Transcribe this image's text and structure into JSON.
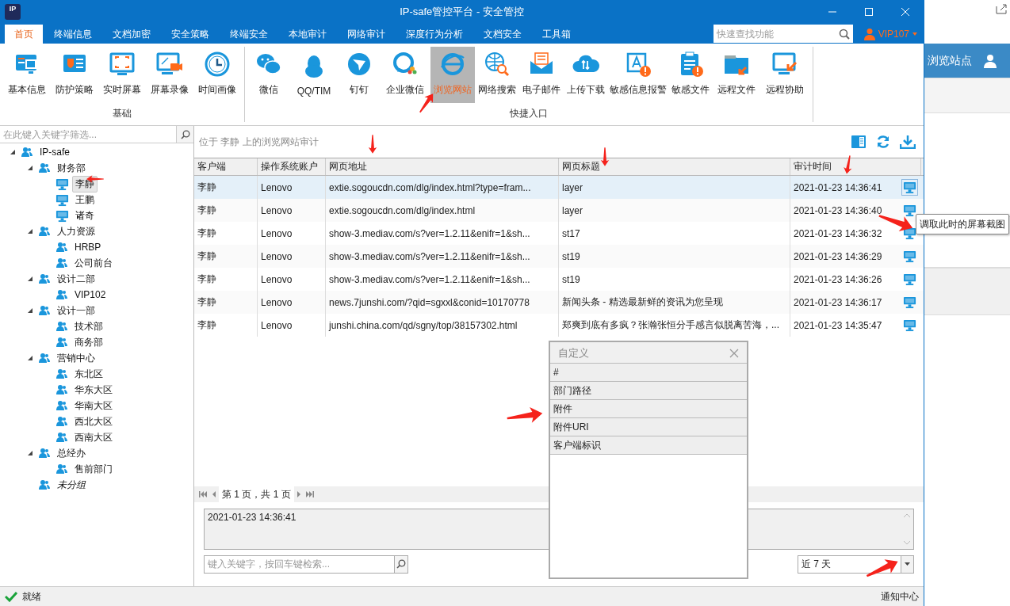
{
  "window": {
    "title": "IP-safe管控平台 - 安全管控",
    "logo": "IP"
  },
  "menu_tabs": [
    {
      "label": "首页",
      "selected": true
    },
    {
      "label": "终端信息",
      "selected": false
    },
    {
      "label": "文档加密",
      "selected": false
    },
    {
      "label": "安全策略",
      "selected": false
    },
    {
      "label": "终端安全",
      "selected": false
    },
    {
      "label": "本地审计",
      "selected": false
    },
    {
      "label": "网络审计",
      "selected": false
    },
    {
      "label": "深度行为分析",
      "selected": false
    },
    {
      "label": "文档安全",
      "selected": false
    },
    {
      "label": "工具箱",
      "selected": false
    }
  ],
  "search": {
    "placeholder": "快速查找功能"
  },
  "user": {
    "name": "VIP107"
  },
  "ribbon_groups": [
    {
      "title": "基础",
      "items": [
        {
          "label": "基本信息",
          "selected": false
        },
        {
          "label": "防护策略",
          "selected": false
        },
        {
          "label": "实时屏幕",
          "selected": false
        },
        {
          "label": "屏幕录像",
          "selected": false
        },
        {
          "label": "时间画像",
          "selected": false
        }
      ]
    },
    {
      "title": "快捷入口",
      "items": [
        {
          "label": "微信",
          "selected": false
        },
        {
          "label": "QQ/TIM",
          "selected": false
        },
        {
          "label": "钉钉",
          "selected": false
        },
        {
          "label": "企业微信",
          "selected": false
        },
        {
          "label": "浏览网站",
          "selected": true
        },
        {
          "label": "网络搜索",
          "selected": false
        },
        {
          "label": "电子邮件",
          "selected": false
        },
        {
          "label": "上传下载",
          "selected": false
        },
        {
          "label": "敏感信息报警",
          "selected": false
        },
        {
          "label": "敏感文件",
          "selected": false
        },
        {
          "label": "远程文件",
          "selected": false
        },
        {
          "label": "远程协助",
          "selected": false
        }
      ]
    }
  ],
  "tree": {
    "filter_placeholder": "在此键入关键字筛选...",
    "nodes": [
      {
        "label": "IP-safe",
        "kind": "group",
        "expanded": true,
        "children": [
          {
            "label": "财务部",
            "kind": "group",
            "expanded": true,
            "children": [
              {
                "label": "李静",
                "kind": "computer",
                "selected": true
              },
              {
                "label": "王鹏",
                "kind": "computer",
                "selected": false
              },
              {
                "label": "诸奇",
                "kind": "computer",
                "selected": false
              }
            ]
          },
          {
            "label": "人力资源",
            "kind": "group",
            "expanded": true,
            "children": [
              {
                "label": "HRBP",
                "kind": "group"
              },
              {
                "label": "公司前台",
                "kind": "group"
              }
            ]
          },
          {
            "label": "设计二部",
            "kind": "group",
            "expanded": true,
            "children": [
              {
                "label": "VIP102",
                "kind": "group"
              }
            ]
          },
          {
            "label": "设计一部",
            "kind": "group",
            "expanded": true,
            "children": [
              {
                "label": "技术部",
                "kind": "group"
              },
              {
                "label": "商务部",
                "kind": "group"
              }
            ]
          },
          {
            "label": "营销中心",
            "kind": "group",
            "expanded": true,
            "children": [
              {
                "label": "东北区",
                "kind": "group"
              },
              {
                "label": "华东大区",
                "kind": "group"
              },
              {
                "label": "华南大区",
                "kind": "group"
              },
              {
                "label": "西北大区",
                "kind": "group"
              },
              {
                "label": "西南大区",
                "kind": "group"
              }
            ]
          },
          {
            "label": "总经办",
            "kind": "group",
            "expanded": true,
            "children": [
              {
                "label": "售前部门",
                "kind": "group"
              }
            ]
          },
          {
            "label": "未分组",
            "kind": "ungrouped"
          }
        ]
      }
    ]
  },
  "content": {
    "caption": "位于 李静 上的浏览网站审计",
    "table": {
      "columns": [
        "客户端",
        "操作系统账户",
        "网页地址",
        "网页标题",
        "审计时间"
      ],
      "rows": [
        {
          "cells": [
            "李静",
            "Lenovo",
            "extie.sogoucdn.com/dlg/index.html?type=fram...",
            "layer",
            "2021-01-23 14:36:41"
          ],
          "selected": true
        },
        {
          "cells": [
            "李静",
            "Lenovo",
            "extie.sogoucdn.com/dlg/index.html",
            "layer",
            "2021-01-23 14:36:40"
          ],
          "selected": false
        },
        {
          "cells": [
            "李静",
            "Lenovo",
            "show-3.mediav.com/s?ver=1.2.11&enifr=1&sh...",
            "st17",
            "2021-01-23 14:36:32"
          ],
          "selected": false
        },
        {
          "cells": [
            "李静",
            "Lenovo",
            "show-3.mediav.com/s?ver=1.2.11&enifr=1&sh...",
            "st19",
            "2021-01-23 14:36:29"
          ],
          "selected": false
        },
        {
          "cells": [
            "李静",
            "Lenovo",
            "show-3.mediav.com/s?ver=1.2.11&enifr=1&sh...",
            "st19",
            "2021-01-23 14:36:26"
          ],
          "selected": false
        },
        {
          "cells": [
            "李静",
            "Lenovo",
            "news.7junshi.com/?qid=sgxxl&conid=10170778",
            "新闻头条 - 精选最新鲜的资讯为您呈现",
            "2021-01-23 14:36:17"
          ],
          "selected": false
        },
        {
          "cells": [
            "李静",
            "Lenovo",
            "junshi.china.com/qd/sgny/top/38157302.html",
            "郑爽到底有多疯？张瀚张恒分手感言似脱离苦海，...",
            "2021-01-23 14:35:47"
          ],
          "selected": false
        }
      ]
    },
    "tooltip": "调取此时的屏幕截图",
    "pager": "第 1 页，共 1 页",
    "detail": "2021-01-23 14:36:41",
    "keyword_search": {
      "placeholder": "键入关键字，按回车键检索..."
    },
    "range": {
      "value": "近 7 天"
    }
  },
  "column_dialog": {
    "title": "自定义",
    "items": [
      "#",
      "部门路径",
      "附件",
      "附件URI",
      "客户端标识"
    ]
  },
  "status_bar": {
    "status": "就绪",
    "notice": "通知中心"
  },
  "side_page": {
    "title": "浏览站点"
  }
}
